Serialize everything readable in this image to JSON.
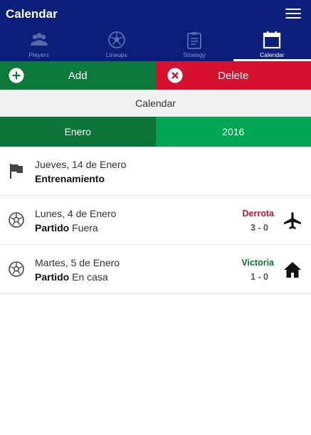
{
  "app": {
    "title": "Calendar"
  },
  "tabs": [
    {
      "label": "Players",
      "icon": "players-icon",
      "active": false
    },
    {
      "label": "Lineups",
      "icon": "soccer-ball-icon",
      "active": false
    },
    {
      "label": "Strategy",
      "icon": "clipboard-icon",
      "active": false
    },
    {
      "label": "Calendar",
      "icon": "calendar-icon",
      "active": true
    }
  ],
  "actions": {
    "add_label": "Add",
    "delete_label": "Delete"
  },
  "section": {
    "title": "Calendar"
  },
  "period": {
    "month": "Enero",
    "year": "2016"
  },
  "events": [
    {
      "date": "Jueves, 14 de Enero",
      "type": "Entrenamiento",
      "detail": "",
      "icon": "flag-icon",
      "result": "",
      "score": "",
      "venue_icon": ""
    },
    {
      "date": "Lunes, 4 de Enero",
      "type": "Partido",
      "detail": "Fuera",
      "icon": "soccer-ball-icon",
      "result": "Derrota",
      "score": "3 - 0",
      "venue_icon": "airplane-icon"
    },
    {
      "date": "Martes, 5 de Enero",
      "type": "Partido",
      "detail": "En casa",
      "icon": "soccer-ball-icon",
      "result": "Victoria",
      "score": "1 - 0",
      "venue_icon": "home-icon"
    }
  ],
  "colors": {
    "header": "#0b1f7a",
    "add": "#0d7a3b",
    "delete": "#d6102f",
    "month": "#0b7438",
    "year": "#00a651",
    "loss": "#c8102e",
    "win": "#0b7438"
  }
}
